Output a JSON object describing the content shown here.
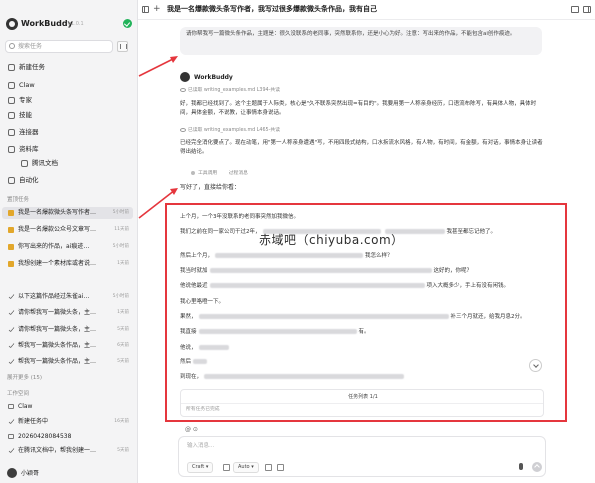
{
  "app": {
    "name": "WorkBuddy",
    "version": "v1.0.1"
  },
  "sidebar": {
    "search_placeholder": "搜索任务",
    "nav": [
      {
        "label": "新建任务"
      },
      {
        "label": "Claw"
      },
      {
        "label": "专家"
      },
      {
        "label": "技能"
      },
      {
        "label": "连接器"
      },
      {
        "label": "资料库"
      },
      {
        "label": "腾讯文档"
      },
      {
        "label": "自动化"
      }
    ],
    "group_recent": "置顶任务",
    "pinned": [
      {
        "label": "我是一名爆款微头条写作者…",
        "time": "5小时前"
      },
      {
        "label": "我是一名爆款公众号文章写…",
        "time": "11天前"
      },
      {
        "label": "你写出来的作品，ai痕迹…",
        "time": "5小时前"
      },
      {
        "label": "我想创建一个素材库或者说…",
        "time": "1天前"
      }
    ],
    "recent": [
      {
        "label": "以下这篇作品经过朱雀ai…",
        "time": "5小时前"
      },
      {
        "label": "请你帮我写一篇微头条，主…",
        "time": "1天前"
      },
      {
        "label": "请你帮我写一篇微头条，主…",
        "time": "5天前"
      },
      {
        "label": "帮我写一篇微头条作品，主…",
        "time": "6天前"
      },
      {
        "label": "帮我写一篇微头条作品，主…",
        "time": "5天前"
      }
    ],
    "more": "展开更多 (15)",
    "group_workspace": "工作空间",
    "workspace": [
      {
        "label": "Claw",
        "time": ""
      },
      {
        "label": "新建任务中",
        "time": "16天前"
      },
      {
        "label": "20260428084538",
        "time": ""
      },
      {
        "label": "在腾讯文档中，帮我创建一…",
        "time": "5天前"
      }
    ],
    "user": "小颖哥"
  },
  "topbar": {
    "title": "我是一名爆款微头条写作者，我写过很多爆款微头条作品，我有自己"
  },
  "chat": {
    "user_message": "请你帮我写一篇微头条作品，主题是：很久没联系的老同事，突然联系你，还是小心为好。注意：写出来的作品，不能包含ai创作痕迹。",
    "assistant_name": "WorkBuddy",
    "read1": "已读取  writing_examples.md L394-共读",
    "para1": "好，我都已经找到了。这个主题属于人际类，核心是\"久不联系突然出现=有目的\"。我要用第一人称亲身经历，口语流布陈写，有具体人物，具体时间，具体金额，不说教，让事情本身说话。",
    "read2": "已读取  writing_examples.md L465-共读",
    "para2": "已经完全消化要点了。现在动笔，用\"第一人称亲身遭遇\"写，不用四段式结构，口水拆流水风格，有人物，有时间，有金额，有对话，事情本身让读者得出结论。",
    "tools": [
      "工具调用",
      "过程消息"
    ],
    "intro": "写好了，直接给你看：",
    "answer": [
      "上个月，一个3年没联系的老同事突然加我微信。",
      "我们之前在同一家公司干过2年，",
      "然后上个月，",
      "我当时就加",
      "他说他最近",
      "我心里咯噔一下。",
      "果然，",
      "我直接",
      "他说，",
      "然后",
      "到现在，"
    ],
    "answer_tails": [
      "",
      "我甚至都忘记他了。",
      "我怎么样？",
      "这好的，你呢？",
      "项入大概多少，手上有没有闲钱。",
      "",
      "补三个月就还，给我月息2分。",
      "有。",
      "",
      "",
      ""
    ],
    "watermark": "赤域吧（chiyuba.com）",
    "task_list_title": "任务列表 1/1",
    "task_list_done": "所有任务已完成"
  },
  "composer": {
    "placeholder": "输入消息...",
    "mode": "Craft",
    "model": "Auto"
  }
}
